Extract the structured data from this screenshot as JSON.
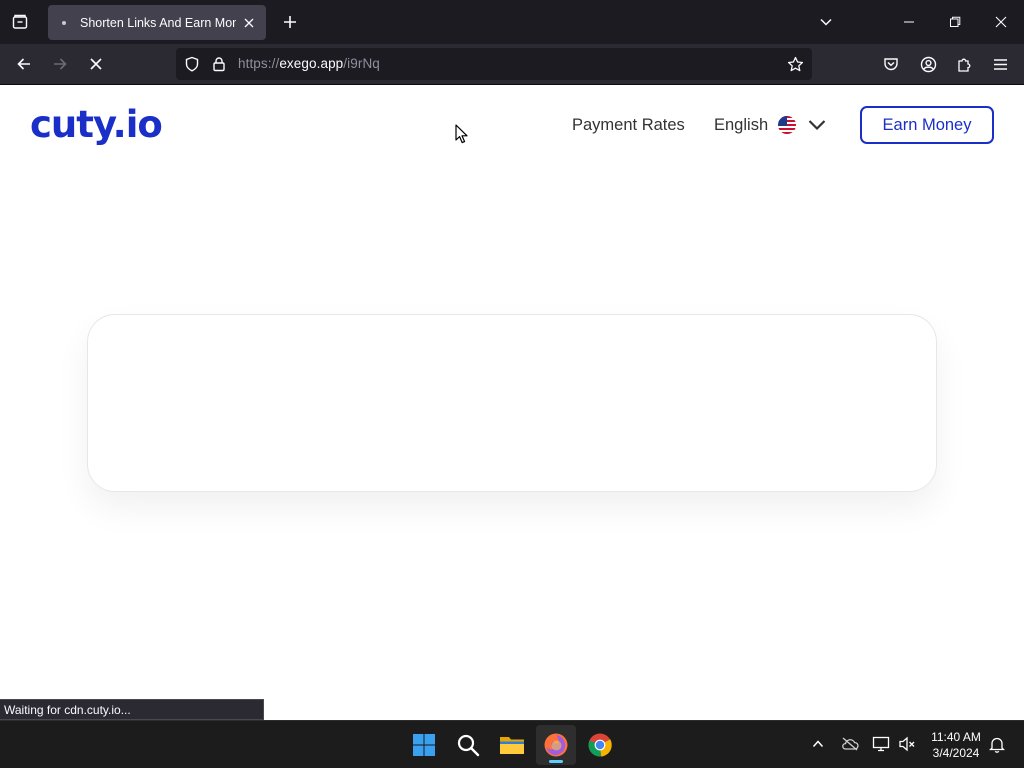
{
  "browser": {
    "tab": {
      "title": "Shorten Links And Earn Money"
    },
    "url": {
      "prefix": "https://",
      "host": "exego.app",
      "path": "/i9rNq"
    },
    "status_text": "Waiting for cdn.cuty.io..."
  },
  "site": {
    "logo_text": "cuty.io",
    "nav": {
      "payment_rates": "Payment Rates"
    },
    "language": {
      "label": "English",
      "flag": "us-flag-icon"
    },
    "cta": {
      "earn_money": "Earn Money"
    },
    "colors": {
      "brand": "#1a2fc7",
      "nav_text": "#333333"
    }
  },
  "taskbar": {
    "apps": [
      "windows-start-icon",
      "search-icon",
      "file-explorer-icon",
      "firefox-icon",
      "chrome-icon"
    ],
    "clock": {
      "time": "11:40 AM",
      "date": "3/4/2024"
    }
  }
}
